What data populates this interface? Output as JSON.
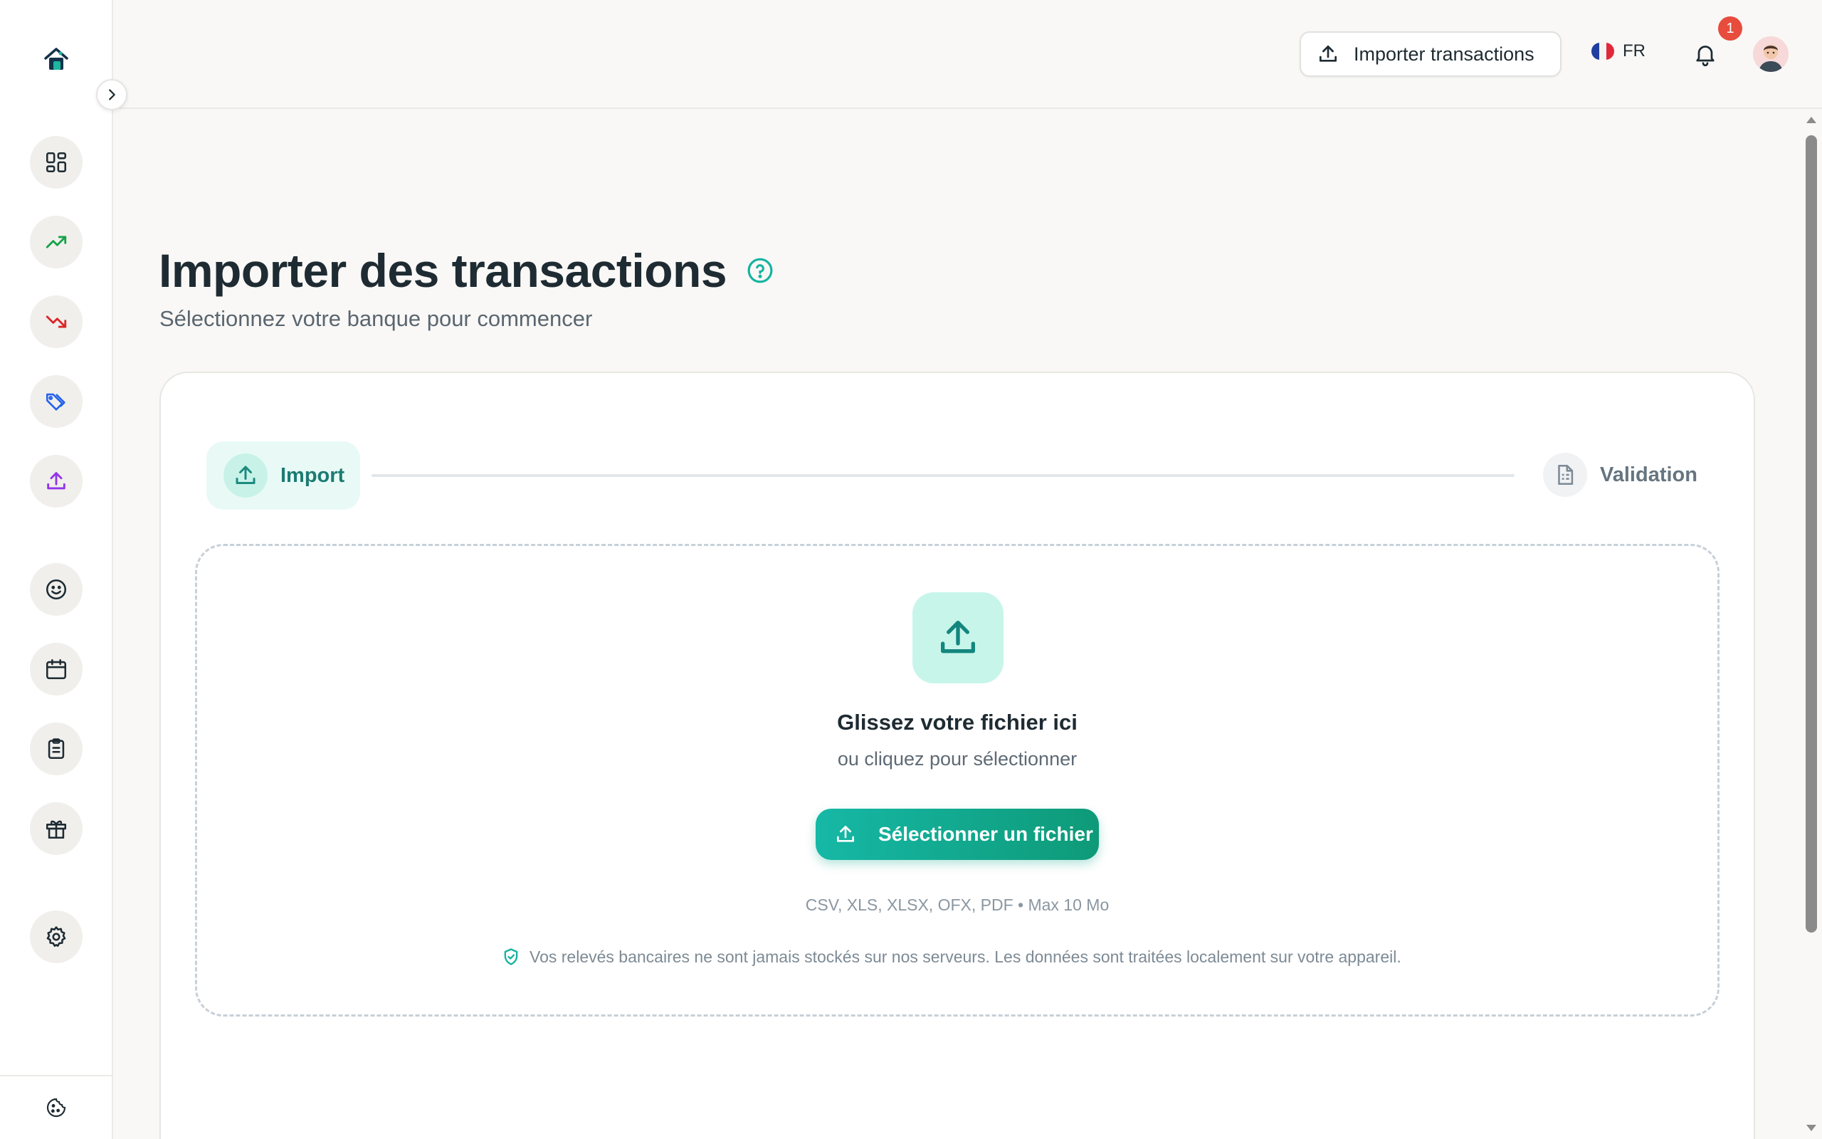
{
  "topbar": {
    "import_button_label": "Importer transactions",
    "language": "FR",
    "notification_count": "1"
  },
  "sidebar": {
    "items": [
      {
        "icon": "dashboard-icon"
      },
      {
        "icon": "trending-up-icon"
      },
      {
        "icon": "trending-down-icon"
      },
      {
        "icon": "tags-icon"
      },
      {
        "icon": "upload-icon"
      },
      {
        "icon": "smile-icon"
      },
      {
        "icon": "calendar-icon"
      },
      {
        "icon": "clipboard-icon"
      },
      {
        "icon": "gift-icon"
      },
      {
        "icon": "gear-icon"
      }
    ],
    "footer_icon": "cookie-icon"
  },
  "main": {
    "title": "Importer des transactions",
    "subtitle": "Sélectionnez votre banque pour commencer",
    "steps": [
      {
        "label": "Import",
        "active": true
      },
      {
        "label": "Validation",
        "active": false
      }
    ],
    "dropzone": {
      "title": "Glissez votre fichier ici",
      "subtitle": "ou cliquez pour sélectionner",
      "button_label": "Sélectionner un fichier",
      "formats": "CSV, XLS, XLSX, OFX, PDF • Max 10 Mo",
      "privacy_note": "Vos relevés bancaires ne sont jamais stockés sur nos serveurs. Les données sont traitées localement sur votre appareil."
    }
  },
  "colors": {
    "accent": "#14b3a0",
    "accent_dark": "#0e9a78",
    "badge": "#e74c3c",
    "background": "#f9f8f6"
  }
}
